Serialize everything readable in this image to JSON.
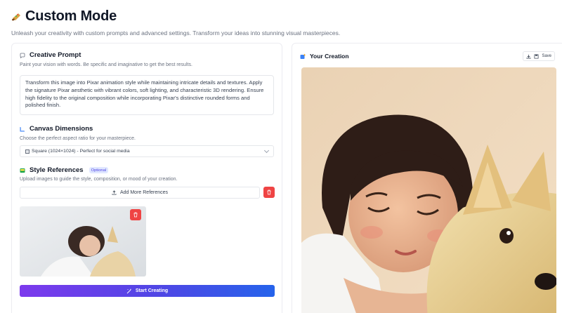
{
  "header": {
    "title": "Custom Mode",
    "title_icon": "palette-icon",
    "subtitle": "Unleash your creativity with custom prompts and advanced settings. Transform your ideas into stunning visual masterpieces."
  },
  "prompt_section": {
    "title": "Creative Prompt",
    "icon": "chat-bubble-icon",
    "description": "Paint your vision with words. Be specific and imaginative to get the best results.",
    "value": "Transform this image into Pixar animation style while maintaining intricate details and textures. Apply the signature Pixar aesthetic with vibrant colors, soft lighting, and characteristic 3D rendering. Ensure high fidelity to the original composition while incorporating Pixar's distinctive rounded forms and polished finish."
  },
  "canvas_section": {
    "title": "Canvas Dimensions",
    "icon": "ruler-icon",
    "description": "Choose the perfect aspect ratio for your masterpiece.",
    "selected": "Square (1024×1024) - Perfect for social media"
  },
  "style_section": {
    "title": "Style References",
    "icon": "image-icon",
    "badge": "Optional",
    "description": "Upload images to guide the style, composition, or mood of your creation.",
    "add_label": "Add More References"
  },
  "actions": {
    "start_label": "Start Creating"
  },
  "creation": {
    "title": "Your Creation",
    "icon": "sparkle-image-icon",
    "save_label": "Save"
  },
  "colors": {
    "accent_gradient_start": "#7c3aed",
    "accent_gradient_end": "#2563eb",
    "danger": "#ef4444",
    "badge_bg": "#e0e7ff"
  }
}
